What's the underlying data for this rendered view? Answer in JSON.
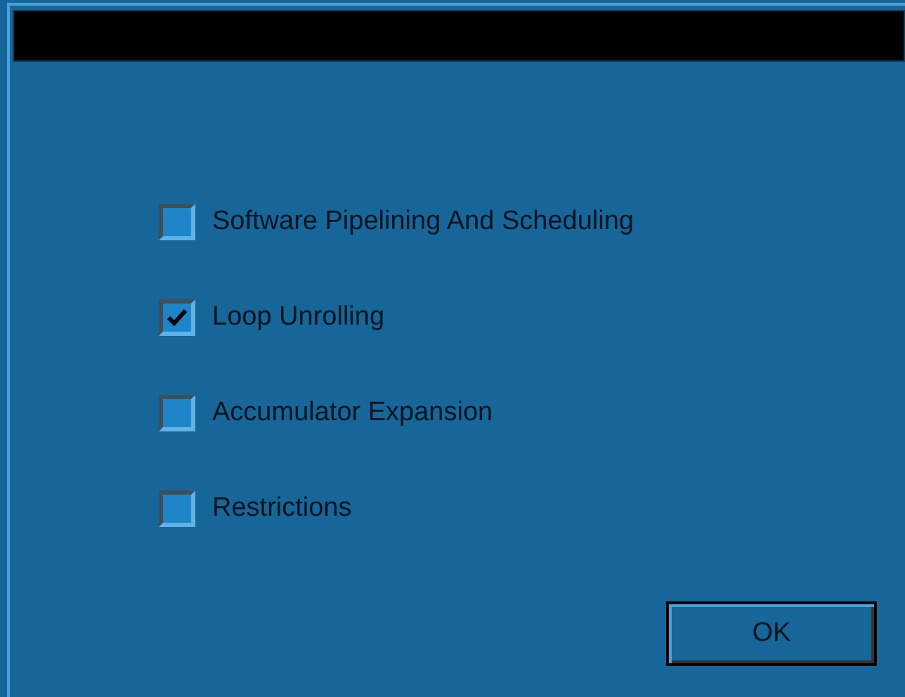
{
  "options": [
    {
      "label": "Software Pipelining And Scheduling",
      "checked": false
    },
    {
      "label": "Loop Unrolling",
      "checked": true
    },
    {
      "label": "Accumulator Expansion",
      "checked": false
    },
    {
      "label": "Restrictions",
      "checked": false
    }
  ],
  "buttons": [
    "OK"
  ]
}
